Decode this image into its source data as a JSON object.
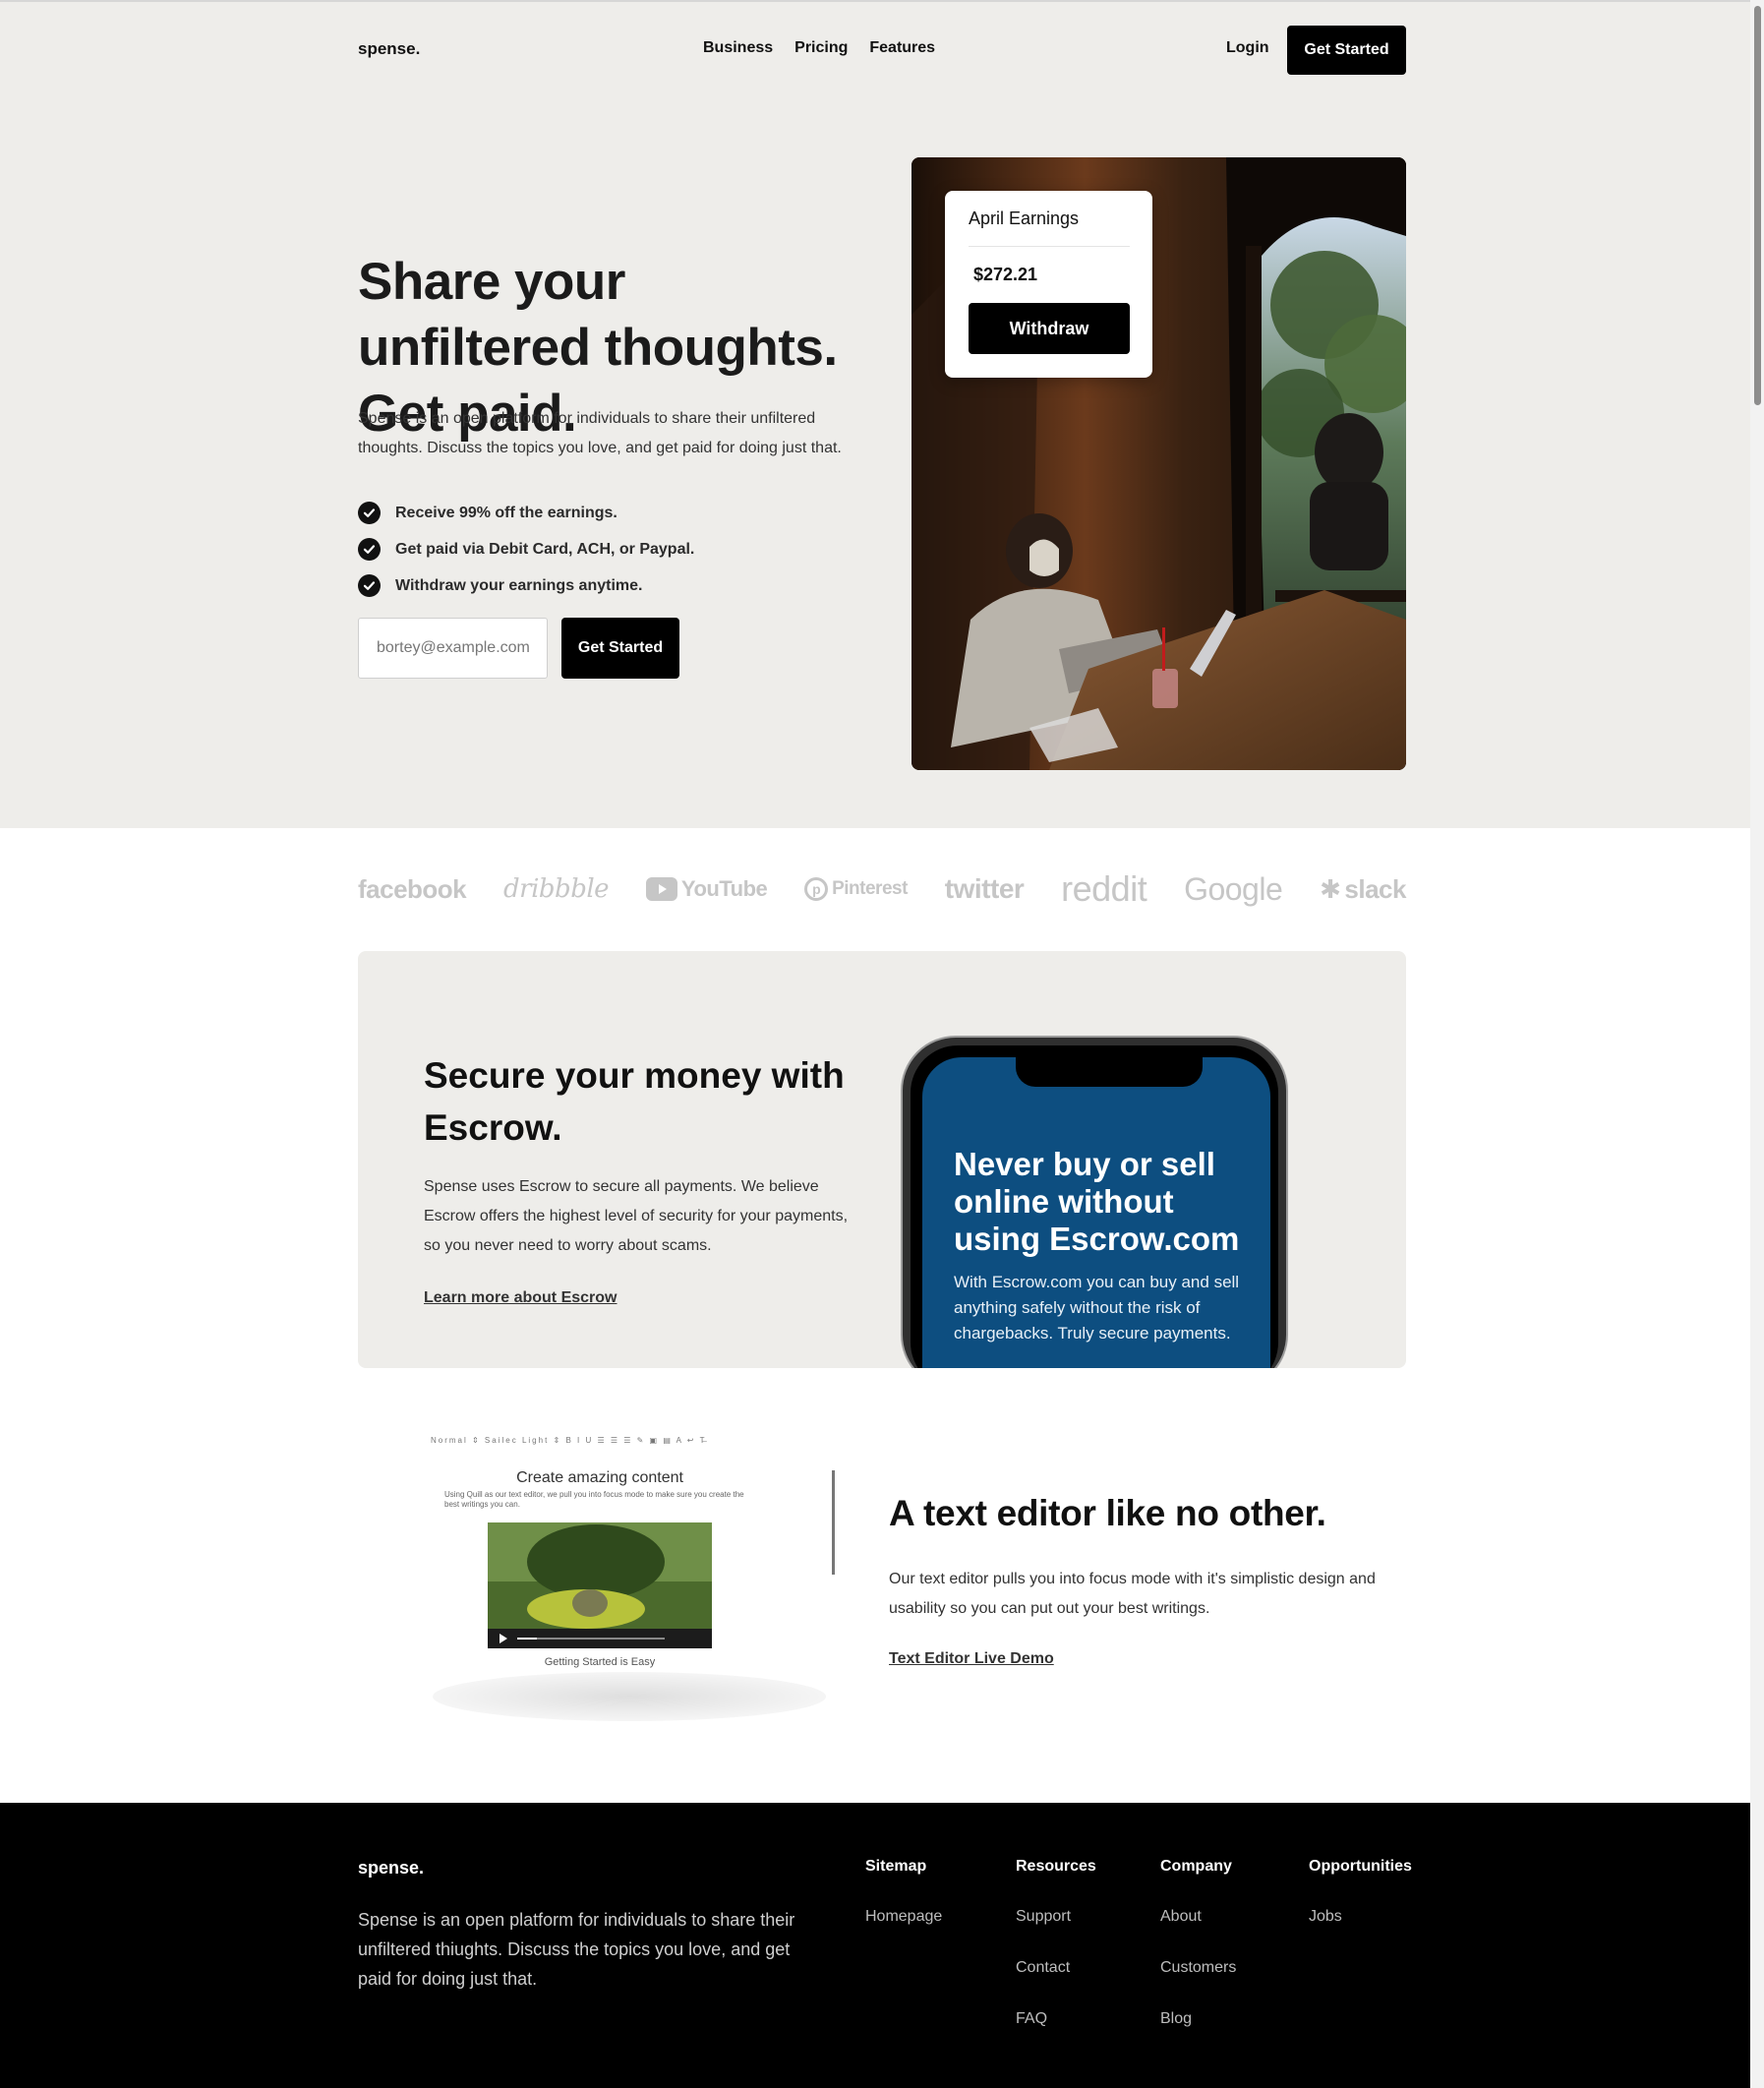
{
  "nav": {
    "logo": "spense.",
    "links": [
      "Business",
      "Pricing",
      "Features"
    ],
    "login": "Login",
    "cta": "Get Started"
  },
  "hero": {
    "title": "Share your unfiltered thoughts. Get paid.",
    "description": "Spense is an open platform for individuals to share their unfiltered thoughts. Discuss the topics you love, and get paid for doing just that.",
    "features": [
      "Receive 99% off the earnings.",
      "Get paid via Debit Card, ACH, or Paypal.",
      "Withdraw your earnings anytime."
    ],
    "email_placeholder": "bortey@example.com",
    "cta": "Get Started",
    "card": {
      "title": "April Earnings",
      "amount": "$272.21",
      "button": "Withdraw"
    }
  },
  "logos": [
    "facebook",
    "dribbble",
    "YouTube",
    "Pinterest",
    "twitter",
    "reddit",
    "Google",
    "slack"
  ],
  "escrow": {
    "title": "Secure your money with Escrow.",
    "description": "Spense uses Escrow to secure all payments. We believe Escrow offers the highest level of security for your payments, so you never need to worry about scams.",
    "link": "Learn more about Escrow",
    "phone_headline": "Never buy or sell online without using Escrow.com",
    "phone_body": "With Escrow.com you can buy and sell anything safely without the risk of chargebacks. Truly secure payments."
  },
  "editor": {
    "preview_toolbar": "Normal  ⇕ Sailec Light  ⇕  B I U  ☰ ☰ ☰  ✎ ▣ ▤  A ↩  T̶",
    "preview_heading": "Create amazing content",
    "preview_sub": "Using Quill as our text editor, we pull you into focus mode to make sure you create the best writings you can.",
    "preview_caption": "Getting Started is Easy",
    "title": "A text editor like no other.",
    "description": "Our text editor pulls you into focus mode with it's simplistic design and usability so you can put out your best writings.",
    "link": "Text Editor Live Demo"
  },
  "footer": {
    "logo": "spense.",
    "description": "Spense is an open platform for individuals to share their unfiltered thiughts. Discuss the topics you love, and get paid for doing just that.",
    "columns": [
      {
        "title": "Sitemap",
        "links": [
          "Homepage"
        ]
      },
      {
        "title": "Resources",
        "links": [
          "Support",
          "Contact",
          "FAQ"
        ]
      },
      {
        "title": "Company",
        "links": [
          "About",
          "Customers",
          "Blog"
        ]
      },
      {
        "title": "Opportunities",
        "links": [
          "Jobs"
        ]
      }
    ]
  },
  "colors": {
    "hero_bg": "#eeedea",
    "accent": "#000000",
    "phone_screen": "#0d4e80",
    "logo_gray": "#c6c6c6"
  }
}
